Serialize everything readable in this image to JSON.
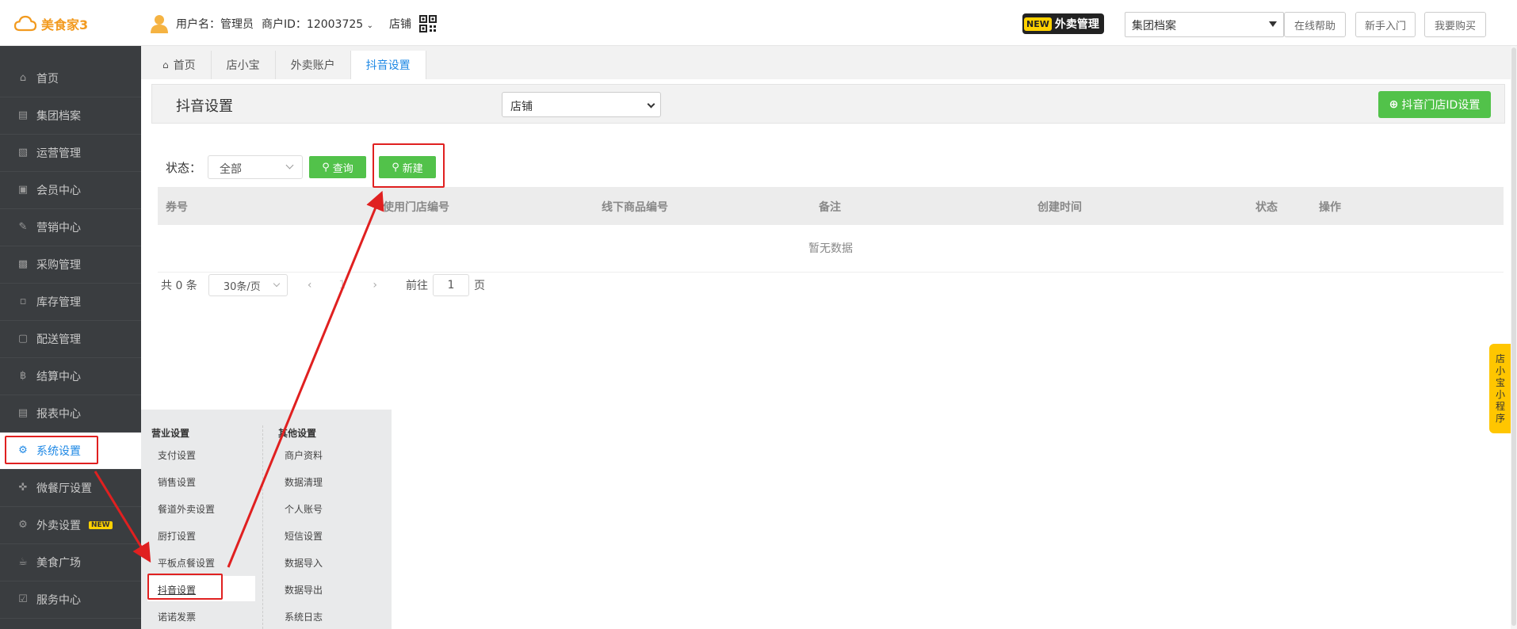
{
  "app": {
    "logo_text": "美食家3",
    "brand_color": "#f29a1f"
  },
  "header": {
    "user_label": "用户名：管理员",
    "merchant_label": "商户ID：12003725",
    "store_label": "店铺",
    "new_tag": "NEW",
    "waimai_label": "外卖管理",
    "group_select_value": "集团档案",
    "help_button": "在线帮助",
    "guide_button": "新手入门",
    "buy_button": "我要购买"
  },
  "sidebar": {
    "items": [
      {
        "label": "首页",
        "icon": "home-icon"
      },
      {
        "label": "集团档案",
        "icon": "file-icon"
      },
      {
        "label": "运营管理",
        "icon": "bar-chart-icon"
      },
      {
        "label": "会员中心",
        "icon": "id-card-icon"
      },
      {
        "label": "营销中心",
        "icon": "edit-icon"
      },
      {
        "label": "采购管理",
        "icon": "book-icon"
      },
      {
        "label": "库存管理",
        "icon": "building-icon"
      },
      {
        "label": "配送管理",
        "icon": "truck-icon"
      },
      {
        "label": "结算中心",
        "icon": "bitcoin-icon"
      },
      {
        "label": "报表中心",
        "icon": "report-icon"
      },
      {
        "label": "系统设置",
        "icon": "gears-icon"
      },
      {
        "label": "微餐厅设置",
        "icon": "cutlery-icon"
      },
      {
        "label": "外卖设置",
        "icon": "gear-icon",
        "badge": "NEW"
      },
      {
        "label": "美食广场",
        "icon": "coffee-icon"
      },
      {
        "label": "服务中心",
        "icon": "check-square-icon"
      }
    ]
  },
  "tabs": [
    {
      "label": "首页",
      "icon": "home-icon"
    },
    {
      "label": "店小宝"
    },
    {
      "label": "外卖账户"
    },
    {
      "label": "抖音设置"
    }
  ],
  "page": {
    "title": "抖音设置",
    "store_select_value": "店铺",
    "douyin_store_button": "抖音门店ID设置",
    "filter_label": "状态：",
    "status_select_value": "全部",
    "query_button": "查询",
    "new_button": "新建"
  },
  "table": {
    "columns": [
      "券号",
      "使用门店编号",
      "线下商品编号",
      "备注",
      "创建时间",
      "状态",
      "操作"
    ],
    "empty_text": "暂无数据"
  },
  "pager": {
    "total_text": "共 0 条",
    "page_size": "30条/页",
    "current_page": "1",
    "goto_label": "前往",
    "goto_value": "1",
    "page_unit": "页"
  },
  "submenu": {
    "left_title": "营业设置",
    "left_items": [
      "支付设置",
      "销售设置",
      "餐道外卖设置",
      "厨打设置",
      "平板点餐设置",
      "抖音设置",
      "诺诺发票"
    ],
    "right_title": "其他设置",
    "right_items": [
      "商户资料",
      "数据清理",
      "个人账号",
      "短信设置",
      "数据导入",
      "数据导出",
      "系统日志"
    ]
  },
  "float_bar": {
    "text": "店小宝小程序"
  },
  "colors": {
    "green": "#52c24a",
    "sidebar_bg": "#3a3d40",
    "highlight_red": "#e02020",
    "link_blue": "#1e88e5"
  }
}
